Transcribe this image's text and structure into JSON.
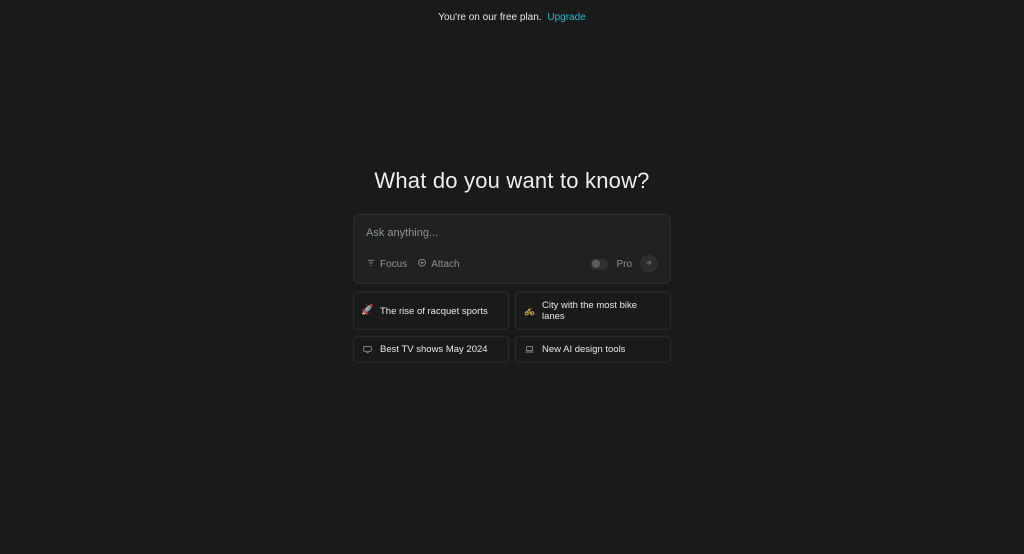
{
  "banner": {
    "text": "You're on our free plan.",
    "upgrade_label": "Upgrade"
  },
  "headline": "What do you want to know?",
  "search": {
    "placeholder": "Ask anything...",
    "value": "",
    "focus_label": "Focus",
    "attach_label": "Attach",
    "pro_label": "Pro"
  },
  "suggestions": [
    {
      "icon": "🚀",
      "label": "The rise of racquet sports"
    },
    {
      "icon": "🚲",
      "label": "City with the most bike lanes",
      "icon_color": "#d4a139"
    },
    {
      "icon": "📺",
      "label": "Best TV shows May 2024"
    },
    {
      "icon": "💻",
      "label": "New AI design tools"
    }
  ]
}
